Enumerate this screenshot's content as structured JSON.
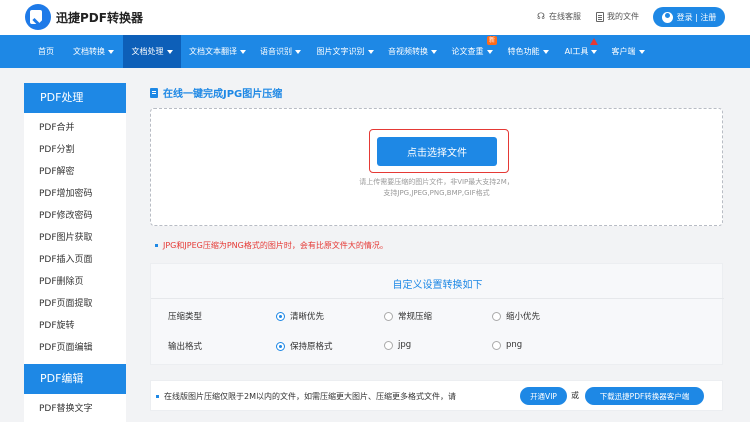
{
  "header": {
    "brand": "迅捷PDF转换器",
    "online_service": "在线客服",
    "my_files": "我的文件",
    "login": "登录 | 注册"
  },
  "nav": {
    "items": [
      {
        "label": "首页",
        "dropdown": false
      },
      {
        "label": "文档转换",
        "dropdown": true
      },
      {
        "label": "文档处理",
        "dropdown": true,
        "active": true
      },
      {
        "label": "文档文本翻译",
        "dropdown": true
      },
      {
        "label": "语音识别",
        "dropdown": true
      },
      {
        "label": "图片文字识别",
        "dropdown": true
      },
      {
        "label": "音视频转换",
        "dropdown": true
      },
      {
        "label": "论文查重",
        "dropdown": true
      },
      {
        "label": "特色功能",
        "dropdown": true
      },
      {
        "label": "AI工具",
        "dropdown": true
      },
      {
        "label": "客户端",
        "dropdown": true
      }
    ],
    "new_badge": "新"
  },
  "sidebar": {
    "group1_title": "PDF处理",
    "group1_items": [
      "PDF合并",
      "PDF分割",
      "PDF解密",
      "PDF增加密码",
      "PDF修改密码",
      "PDF图片获取",
      "PDF插入页面",
      "PDF删除页",
      "PDF页面提取",
      "PDF旋转",
      "PDF页面编辑"
    ],
    "group2_title": "PDF编辑",
    "group2_items": [
      "PDF替换文字"
    ]
  },
  "main": {
    "title": "在线一键完成JPG图片压缩",
    "select_button": "点击选择文件",
    "hint_line1": "请上传需要压缩的图片文件，非VIP最大支持2M，",
    "hint_line2": "支持JPG,JPEG,PNG,BMP,GIF格式",
    "warning": "JPG和JPEG压缩为PNG格式的图片时，会有比原文件大的情况。"
  },
  "settings": {
    "title": "自定义设置转换如下",
    "compress_label": "压缩类型",
    "compress_options": [
      "清晰优先",
      "常规压缩",
      "缩小优先"
    ],
    "compress_selected": 0,
    "format_label": "输出格式",
    "format_options": [
      "保持原格式",
      "jpg",
      "png"
    ],
    "format_selected": 0
  },
  "limit": {
    "text": "在线版图片压缩仅限于2M以内的文件，如需压缩更大图片、压缩更多格式文件，请",
    "vip_button": "开通VIP",
    "or": "或",
    "download_button": "下载迅捷PDF转换器客户端"
  },
  "colors": {
    "primary": "#1e88e5",
    "nav_active": "#0d5fb8",
    "highlight_red": "#e53935",
    "badge_orange": "#ff6b1a"
  }
}
